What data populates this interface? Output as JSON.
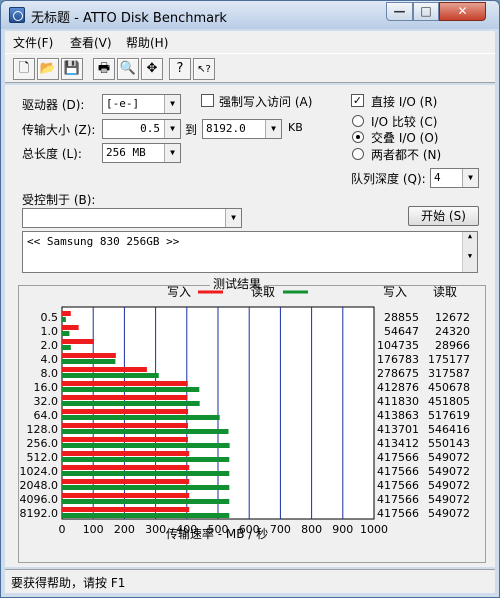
{
  "window": {
    "title": "无标题 - ATTO Disk Benchmark"
  },
  "window_controls": {
    "minimize": "—",
    "maximize": "□",
    "close": "✕"
  },
  "menus": [
    "文件(F)",
    "查看(V)",
    "帮助(H)"
  ],
  "toolbar": {
    "buttons": [
      {
        "name": "new-icon",
        "glyph": "🗋"
      },
      {
        "name": "open-icon",
        "glyph": "📂"
      },
      {
        "name": "save-icon",
        "glyph": "💾"
      },
      {
        "name": "print-icon",
        "glyph": "🖶"
      },
      {
        "name": "print-preview-icon",
        "glyph": "🔍"
      },
      {
        "name": "move-icon",
        "glyph": "✥"
      },
      {
        "name": "help-icon",
        "glyph": "?"
      },
      {
        "name": "context-help-icon",
        "glyph": "↖?"
      }
    ]
  },
  "form": {
    "drive_label": "驱动器 (D):",
    "drive_value": "[-e-]",
    "transfer_size_label": "传输大小 (Z):",
    "transfer_from": "0.5",
    "to_label": "到",
    "transfer_to": "8192.0",
    "kb_unit": "KB",
    "total_length_label": "总长度 (L):",
    "total_length_value": "256 MB",
    "force_write_label": "强制写入访问 (A)",
    "direct_io_label": "直接 I/O (R)",
    "direct_io_checked": true,
    "io_compare_label": "I/O 比较 (C)",
    "overlapped_io_label": "交叠 I/O (O)",
    "neither_label": "两者都不 (N)",
    "selected_mode": "overlapped",
    "queue_depth_label": "队列深度 (Q):",
    "queue_depth_value": "4",
    "controlled_by_label": "受控制于 (B):",
    "controlled_by_value": "",
    "start_button": "开始 (S)",
    "description": "<< Samsung 830 256GB >>"
  },
  "results": {
    "title": "测试结果",
    "legend_write": "写入",
    "legend_read": "读取",
    "write_header": "写入",
    "read_header": "读取",
    "write_color": "#ee1c1c",
    "read_color": "#109030"
  },
  "status": {
    "text": "要获得帮助，请按 F1"
  },
  "chart_data": {
    "type": "bar",
    "orientation": "horizontal",
    "categories": [
      "0.5",
      "1.0",
      "2.0",
      "4.0",
      "8.0",
      "16.0",
      "32.0",
      "64.0",
      "128.0",
      "256.0",
      "512.0",
      "1024.0",
      "2048.0",
      "4096.0",
      "8192.0"
    ],
    "series": [
      {
        "name": "写入",
        "values": [
          28855,
          54647,
          104735,
          176783,
          278675,
          412876,
          411830,
          413863,
          413701,
          413412,
          417566,
          417566,
          417566,
          417566,
          417566
        ]
      },
      {
        "name": "读取",
        "values": [
          12672,
          24320,
          28966,
          175177,
          317587,
          450678,
          451805,
          517619,
          546416,
          550143,
          549072,
          549072,
          549072,
          549072,
          549072
        ]
      }
    ],
    "xlabel": "传输速率 - MB / 秒",
    "xticks": [
      0,
      100,
      200,
      300,
      400,
      500,
      600,
      700,
      800,
      900,
      1000
    ],
    "xlim": [
      0,
      1000
    ],
    "grid": true
  }
}
